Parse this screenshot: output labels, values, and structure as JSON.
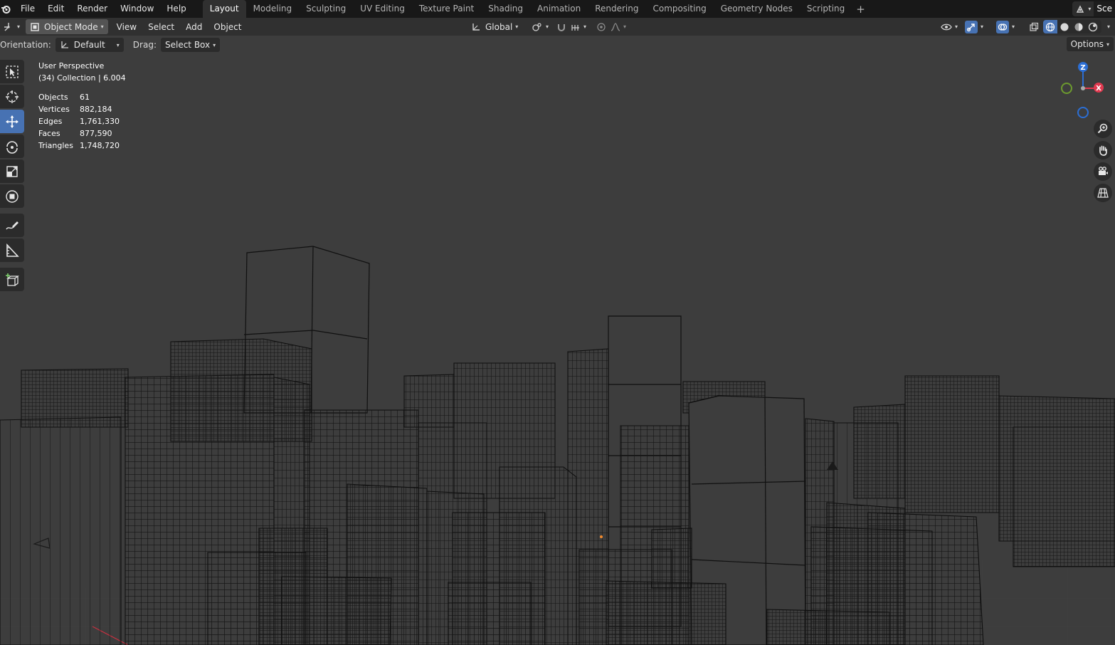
{
  "menu": [
    "File",
    "Edit",
    "Render",
    "Window",
    "Help"
  ],
  "workspaces": [
    "Layout",
    "Modeling",
    "Sculpting",
    "UV Editing",
    "Texture Paint",
    "Shading",
    "Animation",
    "Rendering",
    "Compositing",
    "Geometry Nodes",
    "Scripting"
  ],
  "active_workspace": "Layout",
  "scene_name": "Sce",
  "header": {
    "mode": "Object Mode",
    "view": "View",
    "select": "Select",
    "add": "Add",
    "object": "Object",
    "transform_orientation": "Global"
  },
  "tool_settings": {
    "orientation_label": "Orientation:",
    "orientation_value": "Default",
    "drag_label": "Drag:",
    "drag_value": "Select Box",
    "options": "Options"
  },
  "overlay": {
    "view_name": "User Perspective",
    "collection": "(34) Collection | 6.004",
    "stats": [
      {
        "label": "Objects",
        "value": "61"
      },
      {
        "label": "Vertices",
        "value": "882,184"
      },
      {
        "label": "Edges",
        "value": "1,761,330"
      },
      {
        "label": "Faces",
        "value": "877,590"
      },
      {
        "label": "Triangles",
        "value": "1,748,720"
      }
    ]
  },
  "gizmo": {
    "z": "Z",
    "x": "X"
  },
  "colors": {
    "viewport_bg": "#3d3d3d",
    "active_tool": "#4772b3",
    "axis_x": "#e0394f",
    "axis_y": "#6c9a2e",
    "axis_z": "#2c6ed4",
    "wire": "#101010"
  }
}
